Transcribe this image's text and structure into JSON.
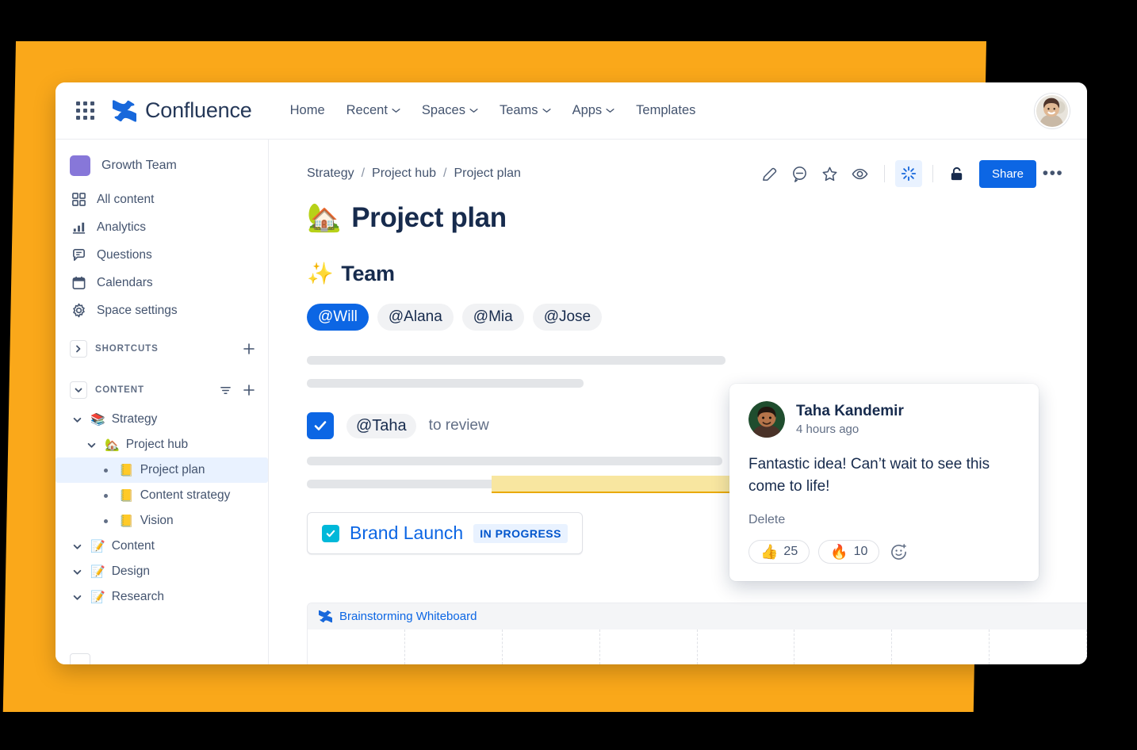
{
  "brand": {
    "name": "Confluence",
    "logo_color": "#1868DB"
  },
  "topnav": {
    "app_switcher": "app-switcher-icon",
    "links": [
      {
        "label": "Home",
        "has_caret": false
      },
      {
        "label": "Recent",
        "has_caret": true
      },
      {
        "label": "Spaces",
        "has_caret": true
      },
      {
        "label": "Teams",
        "has_caret": true
      },
      {
        "label": "Apps",
        "has_caret": true
      },
      {
        "label": "Templates",
        "has_caret": false
      }
    ],
    "avatar": "user-avatar"
  },
  "sidebar": {
    "space": {
      "name": "Growth Team",
      "color": "#8777D9"
    },
    "nav": [
      {
        "label": "All content",
        "icon": "grid-icon"
      },
      {
        "label": "Analytics",
        "icon": "bar-chart-icon"
      },
      {
        "label": "Questions",
        "icon": "speech-bubble-icon"
      },
      {
        "label": "Calendars",
        "icon": "calendar-icon"
      },
      {
        "label": "Space settings",
        "icon": "gear-icon"
      }
    ],
    "shortcuts": {
      "title": "SHORTCUTS",
      "add": "+"
    },
    "content": {
      "title": "CONTENT",
      "filter": "filter-icon",
      "add": "+"
    },
    "tree": [
      {
        "label": "Strategy",
        "emoji": "📚",
        "depth": 0,
        "twisty": "down",
        "selected": false
      },
      {
        "label": "Project hub",
        "emoji": "🏡",
        "depth": 1,
        "twisty": "down",
        "selected": false
      },
      {
        "label": "Project plan",
        "emoji": "📒",
        "depth": 2,
        "twisty": "bullet",
        "selected": true
      },
      {
        "label": "Content strategy",
        "emoji": "📒",
        "depth": 2,
        "twisty": "bullet",
        "selected": false
      },
      {
        "label": "Vision",
        "emoji": "📒",
        "depth": 2,
        "twisty": "bullet",
        "selected": false
      },
      {
        "label": "Content",
        "emoji": "📝",
        "depth": 0,
        "twisty": "down",
        "selected": false
      },
      {
        "label": "Design",
        "emoji": "📝",
        "depth": 0,
        "twisty": "down",
        "selected": false
      },
      {
        "label": "Research",
        "emoji": "📝",
        "depth": 0,
        "twisty": "down",
        "selected": false
      }
    ]
  },
  "page": {
    "breadcrumbs": [
      "Strategy",
      "Project hub",
      "Project plan"
    ],
    "breadcrumb_separator": "/",
    "toolbar": {
      "edit": "pencil-icon",
      "comment": "comment-icon",
      "star": "star-icon",
      "watch": "eye-icon",
      "ai": "atlassian-intelligence-icon",
      "restrict": "lock-icon",
      "share_label": "Share",
      "more": "•••"
    },
    "title": "Project plan",
    "title_emoji": "🏡",
    "section_heading": "Team",
    "section_emoji": "✨",
    "mentions": [
      {
        "label": "@Will",
        "active": true
      },
      {
        "label": "@Alana",
        "active": false
      },
      {
        "label": "@Mia",
        "active": false
      },
      {
        "label": "@Jose",
        "active": false
      }
    ],
    "task": {
      "mention": "@Taha",
      "text": "to review",
      "checked": true
    },
    "inline_card": {
      "title": "Brand Launch",
      "status": "IN PROGRESS",
      "checked": true
    },
    "whiteboard": {
      "title": "Brainstorming Whiteboard",
      "columns": 8
    }
  },
  "comment": {
    "author": "Taha Kandemir",
    "timestamp": "4 hours ago",
    "text": "Fantastic idea! Can’t wait to see this come to life!",
    "delete_label": "Delete",
    "reactions": [
      {
        "emoji": "👍",
        "count": "25"
      },
      {
        "emoji": "🔥",
        "count": "10"
      }
    ],
    "add_reaction": "add-reaction-icon"
  }
}
